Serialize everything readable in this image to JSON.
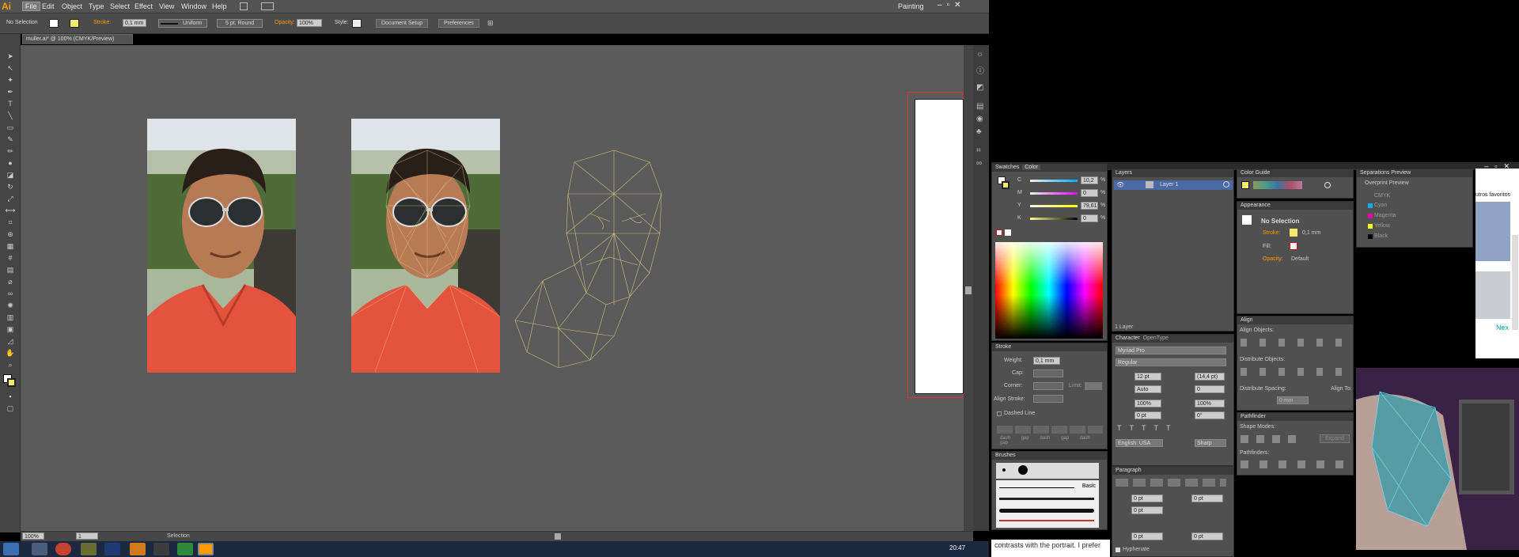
{
  "app": {
    "logo": "Ai",
    "workspace": "Painting"
  },
  "menu": [
    "File",
    "Edit",
    "Object",
    "Type",
    "Select",
    "Effect",
    "View",
    "Window",
    "Help"
  ],
  "control": {
    "selection": "No Selection",
    "stroke_label": "Stroke:",
    "stroke_value": "0,1 mm",
    "profile": "Uniform",
    "brush": "5 pt. Round",
    "opacity_label": "Opacity:",
    "opacity": "100%",
    "style_label": "Style:",
    "doc_setup": "Document Setup",
    "preferences": "Preferences"
  },
  "doc": {
    "tab": "muller.ai* @ 100% (CMYK/Preview)"
  },
  "status": {
    "zoom": "100%",
    "page": "1",
    "tool": "Selection"
  },
  "swatches": {
    "tab1": "Swatches",
    "tab2": "Color",
    "c_label": "C",
    "m_label": "M",
    "y_label": "Y",
    "k_label": "K",
    "c": "10,2",
    "m": "0",
    "y": "79,61",
    "k": "0",
    "pct": "%"
  },
  "layers": {
    "title": "Layers",
    "layer1": "Layer 1",
    "count": "1 Layer"
  },
  "colorguide": {
    "title": "Color Guide"
  },
  "separations": {
    "title": "Separations Preview",
    "overprint": "Overprint Preview",
    "items": [
      "CMYK",
      "Cyan",
      "Magenta",
      "Yellow",
      "Black"
    ]
  },
  "appearance": {
    "title": "Appearance",
    "no_selection": "No Selection",
    "stroke": "Stroke:",
    "stroke_val": "0,1 mm",
    "fill": "Fill:",
    "opacity": "Opacity:",
    "opacity_val": "Default"
  },
  "stroke_panel": {
    "title": "Stroke",
    "weight": "Weight:",
    "weight_val": "0,1 mm",
    "cap": "Cap:",
    "corner": "Corner:",
    "limit": "Limit:",
    "align": "Align Stroke:",
    "dashed": "Dashed Line",
    "dash_labels": [
      "dash",
      "gap",
      "dash",
      "gap",
      "dash",
      "gap"
    ]
  },
  "character": {
    "tab1": "Character",
    "tab2": "OpenType",
    "font": "Myriad Pro",
    "style": "Regular",
    "size": "12 pt",
    "leading": "(14,4 pt)",
    "tracking_a": "Auto",
    "tracking_b": "0",
    "scale_v": "100%",
    "scale_h": "100%",
    "baseline": "0 pt",
    "rotate": "0°",
    "lang": "English: USA",
    "aa": "Sharp"
  },
  "align": {
    "title": "Align",
    "objects": "Align Objects:",
    "distribute": "Distribute Objects:",
    "spacing": "Distribute Spacing:",
    "align_to": "Align To:",
    "spacing_val": "0 mm"
  },
  "pathfinder": {
    "title": "Pathfinder",
    "shape_modes": "Shape Modes:",
    "pathfinders": "Pathfinders:",
    "expand": "Expand"
  },
  "brushes": {
    "title": "Brushes",
    "basic": "Basic"
  },
  "paragraph": {
    "title": "Paragraph",
    "vals": [
      "0 pt",
      "0 pt",
      "0 pt",
      "0 pt",
      "0 pt"
    ],
    "hyphenate": "Hyphenate"
  },
  "web": {
    "favorites": "utros favoritos",
    "caption": "contrasts with the portrait. I prefer",
    "next": "Nex"
  },
  "clock": "20:47",
  "colors": {
    "accent": "#ff9a00",
    "canvas": "#5b5b5b",
    "panel": "#505050",
    "shirt": "#e4533e",
    "mesh": "#c8c27a"
  }
}
